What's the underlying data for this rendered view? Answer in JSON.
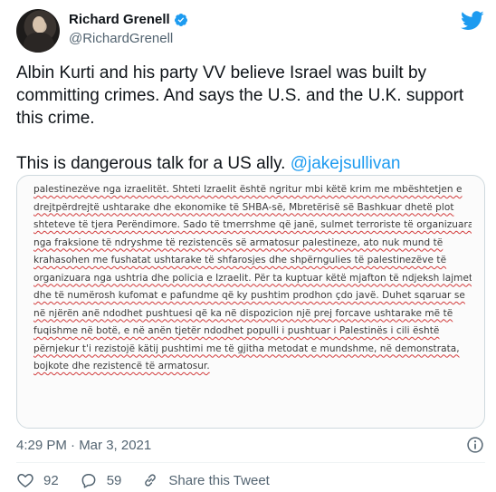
{
  "author": {
    "name": "Richard Grenell",
    "handle": "@RichardGrenell",
    "verified": true
  },
  "tweet": {
    "paragraph1": "Albin Kurti and his party VV believe Israel was built by committing crimes. And says the U.S. and the U.K. support this crime.",
    "paragraph2_text": "This is dangerous talk for a US ally. ",
    "mention": "@jakejsullivan"
  },
  "media": {
    "lines": [
      "palestinezëve nga izraelitët. Shteti Izraelit është ngritur mbi këtë krim me mbështetjen e",
      "drejtpërdrejtë ushtarake dhe ekonomike të SHBA-së, Mbretërisë së Bashkuar dhetë plot",
      "shteteve të tjera Perëndimore. Sado të tmerrshme që janë, sulmet terroriste të organizuara",
      "nga fraksione të ndryshme të rezistencës së armatosur palestineze, ato nuk mund të",
      "krahasohen me fushatat ushtarake të shfarosjes dhe shpërngulies të palestinezëve të",
      "organizuara nga ushtria dhe policia e Izraelit. Për ta kuptuar këtë mjafton të ndjeksh lajmet",
      "dhe të numërosh kufomat e pafundme që ky pushtim prodhon çdo javë. Duhet sqaruar se",
      "në njërën anë ndodhet pushtuesi që ka në dispozicion një prej forcave ushtarake më të",
      "fuqishme në botë, e në anën tjetër ndodhet populli i pushtuar i Palestinës i cili është",
      "përnjekur t'i rezistojë kätij pushtimi me të gjitha metodat e mundshme, në demonstrata,",
      "bojkote dhe rezistencë të armatosur."
    ]
  },
  "meta": {
    "timestamp": "4:29 PM · Mar 3, 2021"
  },
  "actions": {
    "likes": "92",
    "replies": "59",
    "share_label": "Share this Tweet"
  },
  "colors": {
    "accent": "#1d9bf0",
    "muted_text": "#536471",
    "like_icon": "#f91880",
    "spellcheck_underline": "#d23c3c"
  }
}
